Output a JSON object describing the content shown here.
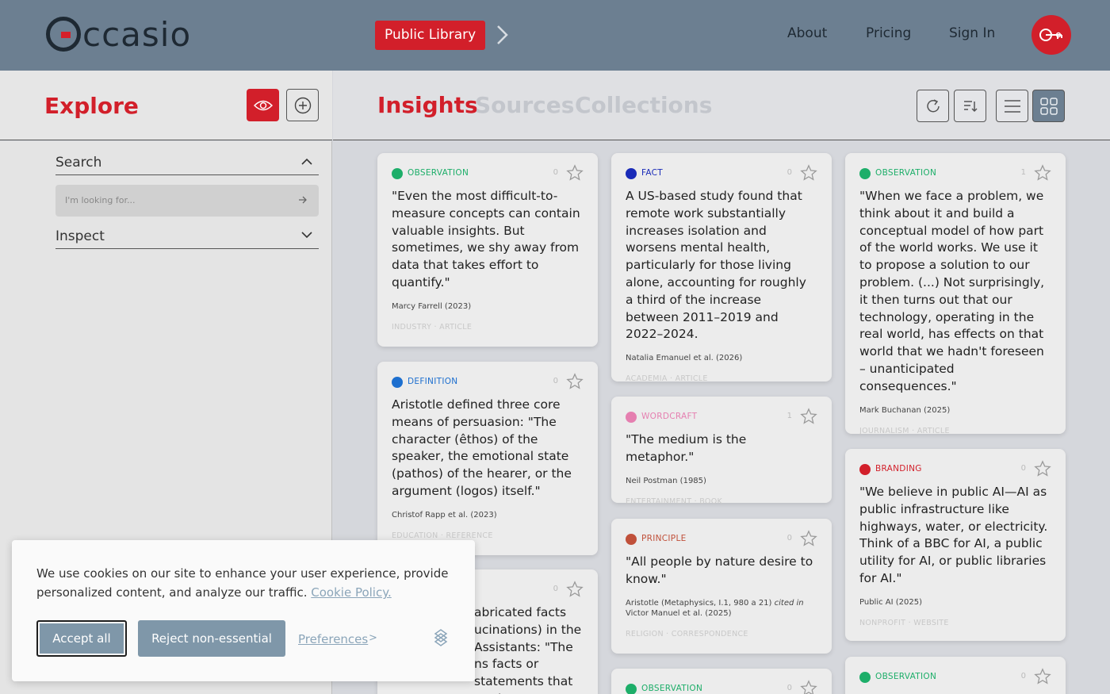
{
  "header": {
    "logo_text": "ccasio",
    "library_label": "Public Library",
    "nav": [
      "About",
      "Pricing",
      "Sign In"
    ]
  },
  "explore": {
    "title": "Explore",
    "search_label": "Search",
    "search_placeholder": "I'm looking for...",
    "inspect_label": "Inspect"
  },
  "tabs": [
    "Insights",
    "Sources",
    "Collections"
  ],
  "cards": [
    {
      "category": "OBSERVATION",
      "color": "#1dae69",
      "count": "0",
      "quote": "\"Even the most difficult-to-measure concepts can contain valuable insights. But sometimes, we shy away from data that takes effort to quantify.\"",
      "author": "Marcy Farrell (2023)",
      "meta": "INDUSTRY · ARTICLE"
    },
    {
      "category": "DEFINITION",
      "color": "#1d6fcf",
      "count": "0",
      "quote": "Aristotle defined three core means of persuasion: \"The character (êthos) of the speaker, the emotional state (pathos) of the hearer, or the argument (logos) itself.\"",
      "author": "Christof Rapp et al. (2023)",
      "meta": "EDUCATION · REFERENCE"
    },
    {
      "category": "",
      "color": "",
      "count": "0",
      "quote": "abricated facts ucinations) in the Assistants: \"The ns facts or statements that are inaccurate",
      "author": "",
      "meta": ""
    },
    {
      "category": "FACT",
      "color": "#1a2bb8",
      "count": "0",
      "quote": "A US-based study found that remote work substantially increases isolation and worsens mental health, particularly for those living alone, accounting for roughly a third of the increase between 2011–2019 and 2022–2024.",
      "author": "Natalia Emanuel et al. (2026)",
      "meta": "ACADEMIA · ARTICLE"
    },
    {
      "category": "WORDCRAFT",
      "color": "#e57fb0",
      "count": "1",
      "quote": "\"The medium is the metaphor.\"",
      "author": "Neil Postman (1985)",
      "meta": "ENTERTAINMENT · BOOK"
    },
    {
      "category": "PRINCIPLE",
      "color": "#c0503a",
      "count": "0",
      "quote": "\"All people by nature desire to know.\"",
      "author": "Aristotle (Metaphysics, I.1, 980 a 21)",
      "author_cited": "cited in",
      "author2": "Victor Manuel et al. (2025)",
      "meta": "RELIGION · CORRESPONDENCE"
    },
    {
      "category": "OBSERVATION",
      "color": "#1dae69",
      "count": "0",
      "quote": "",
      "author": "",
      "meta": ""
    },
    {
      "category": "OBSERVATION",
      "color": "#1dae69",
      "count": "1",
      "quote": "\"When we face a problem, we think about it and build a conceptual model of how part of the world works. We use it to propose a solution to our problem. (...) Not surprisingly, it then turns out that our technology, operating in the real world, has effects on that world that we hadn't foreseen – unanticipated consequences.\"",
      "author": "Mark Buchanan (2025)",
      "meta": "JOURNALISM · ARTICLE"
    },
    {
      "category": "BRANDING",
      "color": "#d21f2a",
      "count": "0",
      "quote": "\"We believe in public AI—AI as public infrastructure like highways, water, or electricity. Think of a BBC for AI, a public utility for AI, or public libraries for AI.\"",
      "author": "Public AI (2025)",
      "meta": "NONPROFIT · WEBSITE"
    },
    {
      "category": "OBSERVATION",
      "color": "#1dae69",
      "count": "0",
      "quote": "",
      "author": "",
      "meta": ""
    }
  ],
  "cookie": {
    "text": "We use cookies on our site to enhance your user experience, provide personalized content, and analyze our traffic.",
    "policy_link": "Cookie Policy.",
    "accept": "Accept all",
    "reject": "Reject non-essential",
    "preferences": "Preferences",
    "pref_arrow": ">"
  }
}
